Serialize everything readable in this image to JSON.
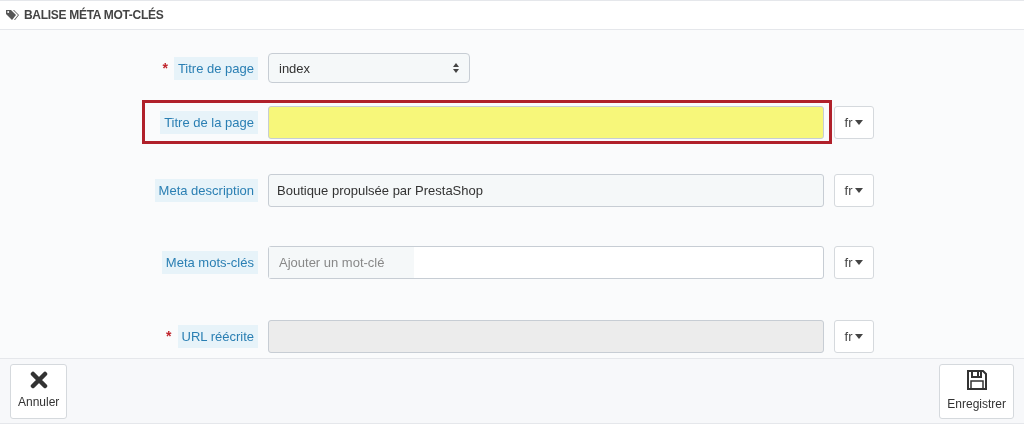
{
  "panel": {
    "title": "BALISE MÉTA MOT-CLÉS"
  },
  "fields": [
    {
      "kind": "select",
      "label": "Titre de page",
      "required_mark": "*",
      "value": "index",
      "highlighted": false
    },
    {
      "kind": "text",
      "label": "Titre de la page",
      "highlighted": true,
      "language": "fr"
    },
    {
      "kind": "text",
      "label": "Meta description",
      "value": "Boutique propulsée par PrestaShop",
      "highlighted": false,
      "language": "fr"
    },
    {
      "kind": "tags",
      "label": "Meta mots-clés",
      "placeholder": "Ajouter un mot-clé",
      "highlighted": false,
      "language": "fr"
    },
    {
      "kind": "text",
      "label": "URL réécrite",
      "required_mark": "*",
      "disabled": true,
      "highlighted": false,
      "language": "fr"
    }
  ],
  "footer": {
    "buttons": [
      {
        "kind": "cancel",
        "label": "Annuler"
      },
      {
        "kind": "save",
        "label": "Enregistrer"
      }
    ]
  }
}
